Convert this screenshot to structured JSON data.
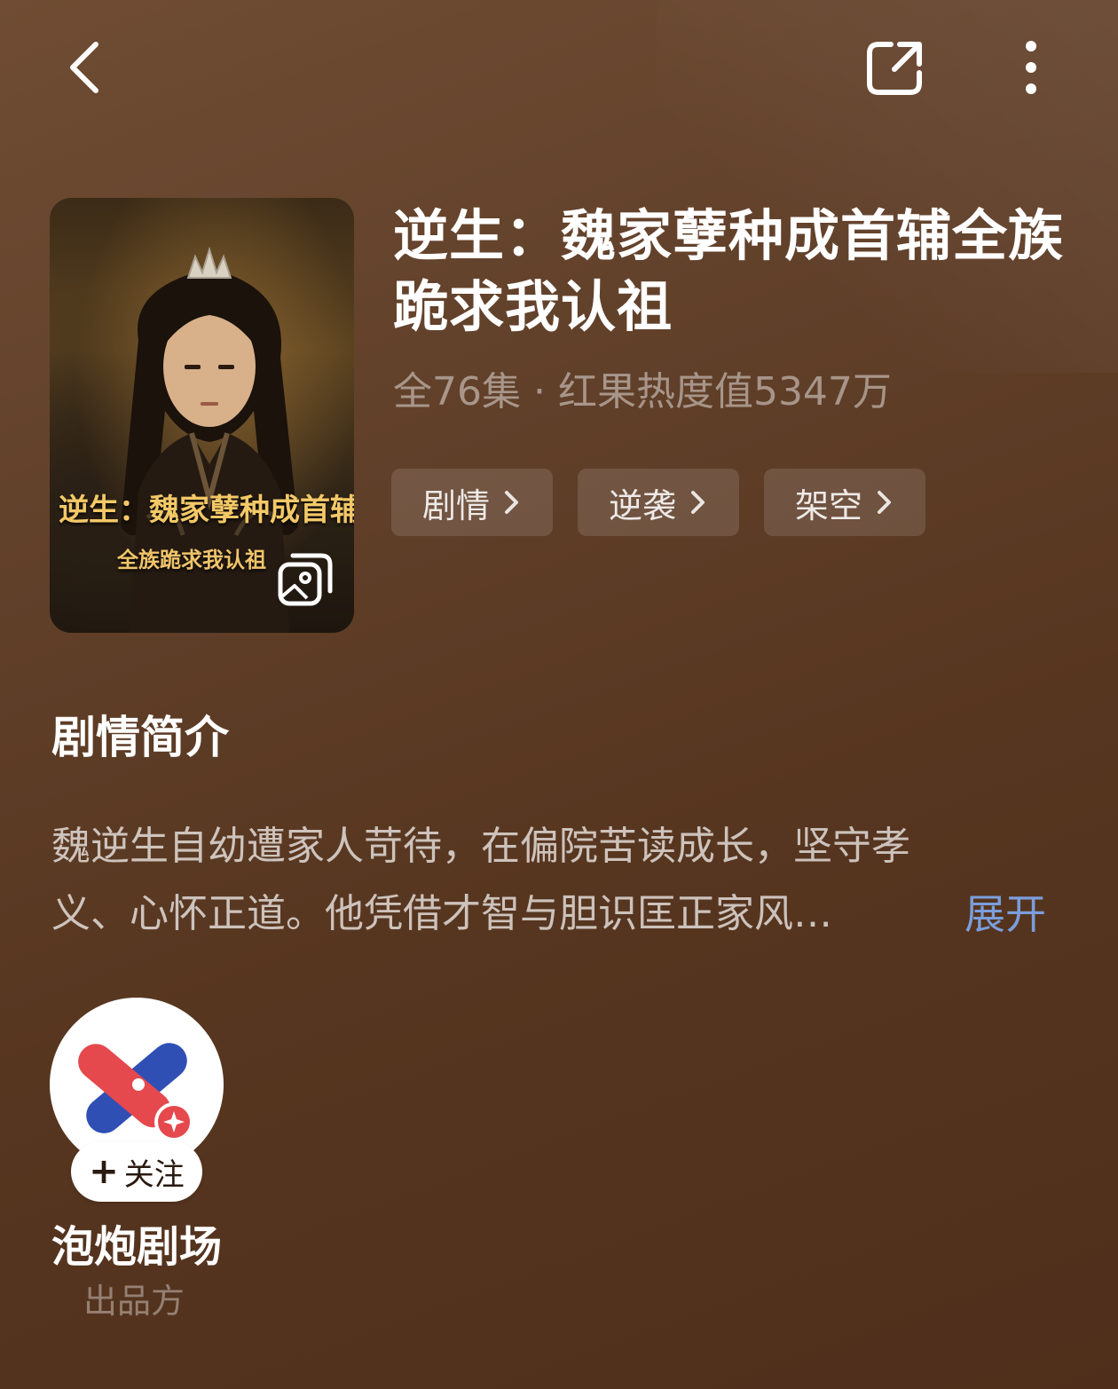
{
  "header": {
    "back_icon": "chevron-left-icon",
    "share_icon": "share-icon",
    "more_icon": "more-vertical-icon"
  },
  "poster": {
    "title_art": "逆生：魏家孽种成首辅",
    "subtitle_art": "全族跪求我认祖",
    "gallery_icon": "gallery-icon"
  },
  "drama": {
    "title": "逆生：魏家孽种成首辅全族跪求我认祖",
    "meta": "全76集 · 红果热度值5347万",
    "tags": [
      {
        "label": "剧情"
      },
      {
        "label": "逆袭"
      },
      {
        "label": "架空"
      }
    ]
  },
  "synopsis": {
    "section_title": "剧情简介",
    "line1": "魏逆生自幼遭家人苛待，在偏院苦读成长，坚守孝",
    "line2": "义、心怀正道。他凭借才智与胆识匡正家风…",
    "expand_label": "展开",
    "expand_color": "#7b9edc"
  },
  "producer": {
    "name": "泡炮剧场",
    "role": "出品方",
    "follow_label": "关注",
    "follow_icon": "plus-icon",
    "logo_colors": {
      "red": "#e5484d",
      "blue": "#2f4fb5"
    }
  },
  "theme": {
    "background": "#5e3d27",
    "text_primary": "#ffffff"
  }
}
